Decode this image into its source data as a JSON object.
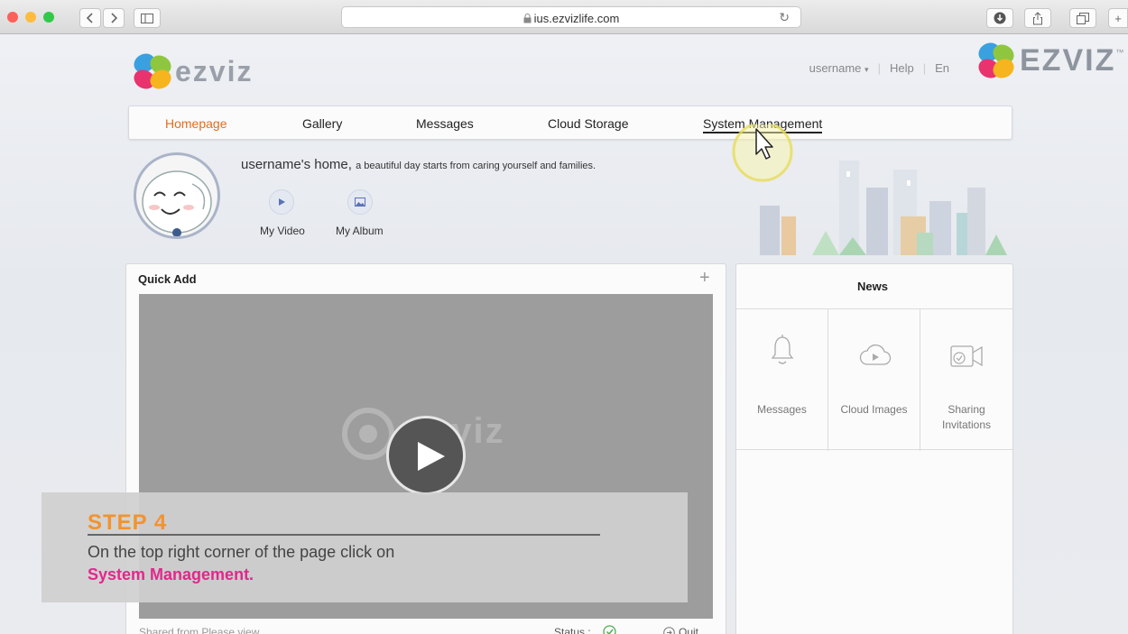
{
  "browser": {
    "url": "ius.ezvizlife.com",
    "back_icon": "chevron-left-icon",
    "forward_icon": "chevron-right-icon",
    "sidebar_icon": "sidebar-icon",
    "lock_icon": "lock-icon",
    "reload_icon": "reload-icon",
    "download_icon": "download-icon",
    "share_icon": "share-icon",
    "tabs_icon": "tabs-icon",
    "new_tab_label": "+"
  },
  "header": {
    "logo_text": "ezviz",
    "top_logo_text": "EZVIZ",
    "trademark": "™",
    "username": "username",
    "help": "Help",
    "language": "En"
  },
  "nav": {
    "items": [
      {
        "label": "Homepage"
      },
      {
        "label": "Gallery"
      },
      {
        "label": "Messages"
      },
      {
        "label": "Cloud Storage"
      },
      {
        "label": "System Management"
      }
    ]
  },
  "home": {
    "title": "username's home",
    "separator": ",",
    "subtitle": "a beautiful day starts from caring yourself and families.",
    "my_video": "My Video",
    "my_album": "My Album"
  },
  "quick_add": {
    "title": "Quick Add",
    "add_symbol": "+",
    "video_watermark": "ezviz",
    "shared_text": "Shared from  Please view",
    "status_label": "Status :",
    "quit_label": "Quit"
  },
  "news": {
    "title": "News",
    "items": [
      {
        "label": "Messages",
        "icon": "bell-icon"
      },
      {
        "label": "Cloud Images",
        "icon": "cloud-play-icon"
      },
      {
        "label": "Sharing Invitations",
        "label_line1": "Sharing",
        "label_line2": "Invitations",
        "icon": "camera-share-icon"
      }
    ]
  },
  "overlay": {
    "step_title": "STEP 4",
    "step_text": "On the top right corner of the page click on",
    "step_highlight": "System Management.",
    "colors": {
      "title": "#f2932e",
      "highlight": "#e0288c"
    }
  },
  "colors": {
    "active_nav": "#e36d1f",
    "brand_gray": "#9aa0aa"
  }
}
